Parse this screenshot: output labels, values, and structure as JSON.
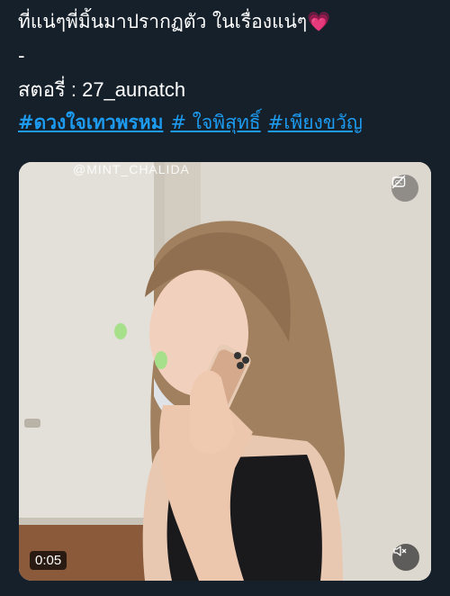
{
  "tweet": {
    "line1_text": "ที่แน่ๆพี่มิ้นมาปรากฏตัว ในเรื่องแน่ๆ",
    "line1_emoji": "💗",
    "separator": "-",
    "story_credit": "สตอรี่ : 27_aunatch",
    "hashtags": [
      "#ดวงใจเทวพรหม",
      "# ใจพิสุทธิ์",
      "#เพียงขวัญ"
    ]
  },
  "media": {
    "watermark": "@MINT_CHALIDA",
    "duration": "0:05",
    "cc_icon": "captions-off-icon",
    "mute_icon": "speaker-muted-icon"
  },
  "colors": {
    "background": "#15202b",
    "text": "#ffffff",
    "link": "#1d9bf0"
  }
}
